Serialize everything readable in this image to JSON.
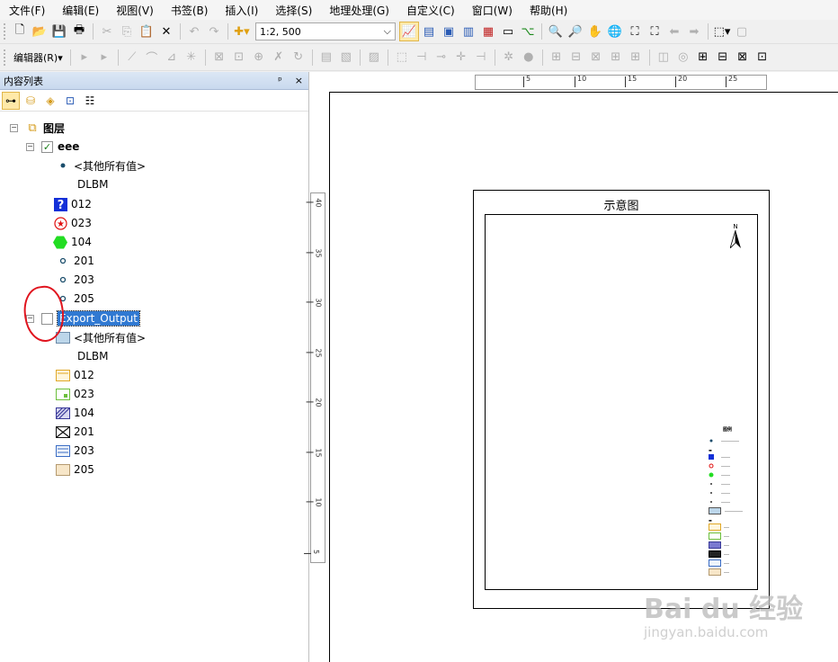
{
  "menu": [
    "文件(F)",
    "编辑(E)",
    "视图(V)",
    "书签(B)",
    "插入(I)",
    "选择(S)",
    "地理处理(G)",
    "自定义(C)",
    "窗口(W)",
    "帮助(H)"
  ],
  "toolbar": {
    "scale_value": "1:2, 500",
    "editor_label": "编辑器(R)▾"
  },
  "toc": {
    "title": "内容列表",
    "pin": "ᵖ",
    "close": "×",
    "root": "图层",
    "layer1": {
      "name": "eee",
      "other_values": "<其他所有值>",
      "field": "DLBM",
      "classes": [
        "012",
        "023",
        "104",
        "201",
        "203",
        "205"
      ]
    },
    "layer2": {
      "name": "Export_Output",
      "other_values": "<其他所有值>",
      "field": "DLBM",
      "classes": [
        "012",
        "023",
        "104",
        "201",
        "203",
        "205"
      ]
    }
  },
  "layout": {
    "title": "示意图",
    "north_label": "N",
    "legend_title": "图例",
    "h_ruler_ticks": [
      "5",
      "10",
      "15",
      "20",
      "25"
    ],
    "v_ruler_ticks": [
      "40",
      "35",
      "30",
      "25",
      "20",
      "15",
      "10",
      "5"
    ]
  },
  "watermark": {
    "main": "Bai du 经验",
    "sub": "jingyan.baidu.com"
  },
  "colors": {
    "selection": "#3079d2",
    "red_mark": "#e0141e",
    "green_hexagon": "#22dd22",
    "blue_question": "#1330d8"
  }
}
